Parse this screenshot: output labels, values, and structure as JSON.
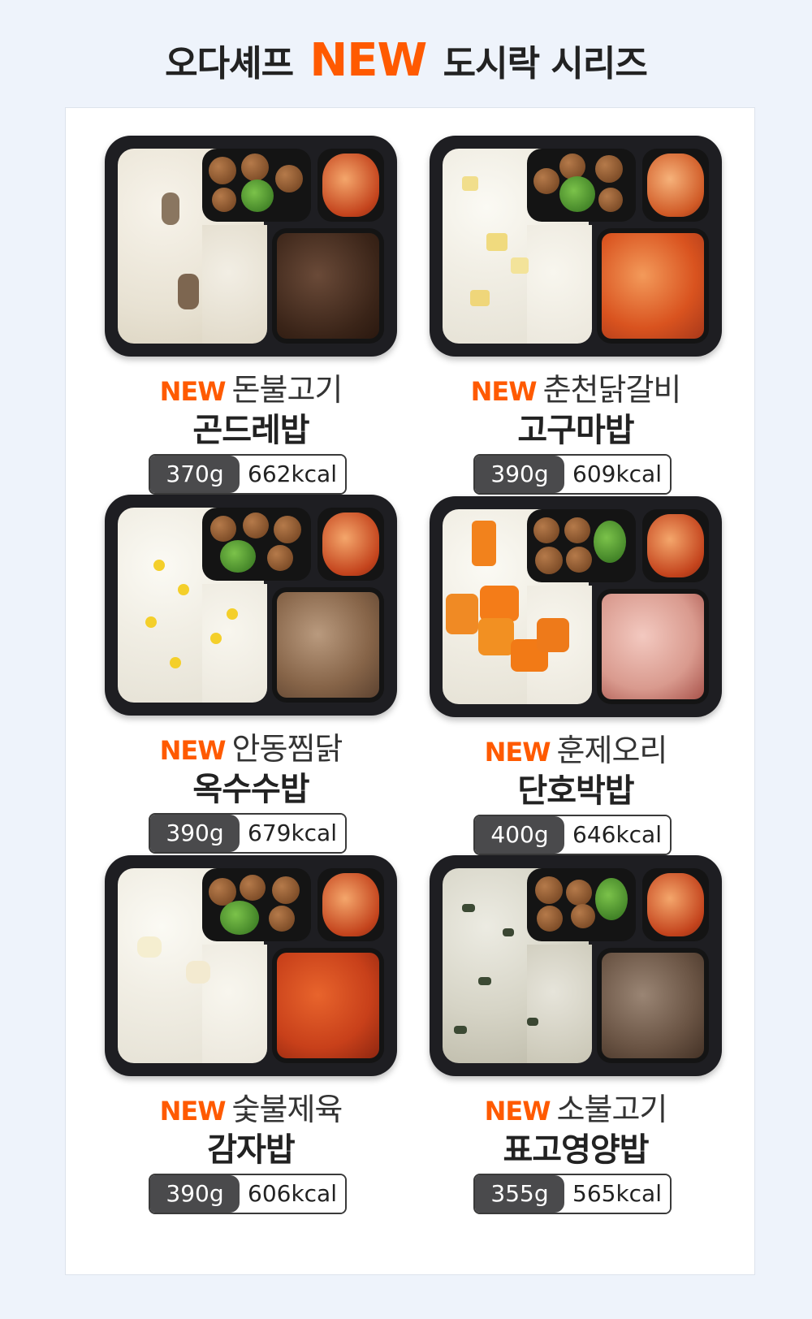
{
  "header": {
    "title_prefix": "오다셰프",
    "title_accent": "NEW",
    "title_suffix": "도시락 시리즈"
  },
  "colors": {
    "accent": "#ff5a00",
    "background": "#eef3fb",
    "tray": "#1e1e22"
  },
  "products": [
    {
      "badge": "NEW",
      "name": "돈불고기",
      "rice": "곤드레밥",
      "weight": "370g",
      "kcal": "662kcal"
    },
    {
      "badge": "NEW",
      "name": "춘천닭갈비",
      "rice": "고구마밥",
      "weight": "390g",
      "kcal": "609kcal"
    },
    {
      "badge": "NEW",
      "name": "안동찜닭",
      "rice": "옥수수밥",
      "weight": "390g",
      "kcal": "679kcal"
    },
    {
      "badge": "NEW",
      "name": "훈제오리",
      "rice": "단호박밥",
      "weight": "400g",
      "kcal": "646kcal"
    },
    {
      "badge": "NEW",
      "name": "숯불제육",
      "rice": "감자밥",
      "weight": "390g",
      "kcal": "606kcal"
    },
    {
      "badge": "NEW",
      "name": "소불고기",
      "rice": "표고영양밥",
      "weight": "355g",
      "kcal": "565kcal"
    }
  ]
}
